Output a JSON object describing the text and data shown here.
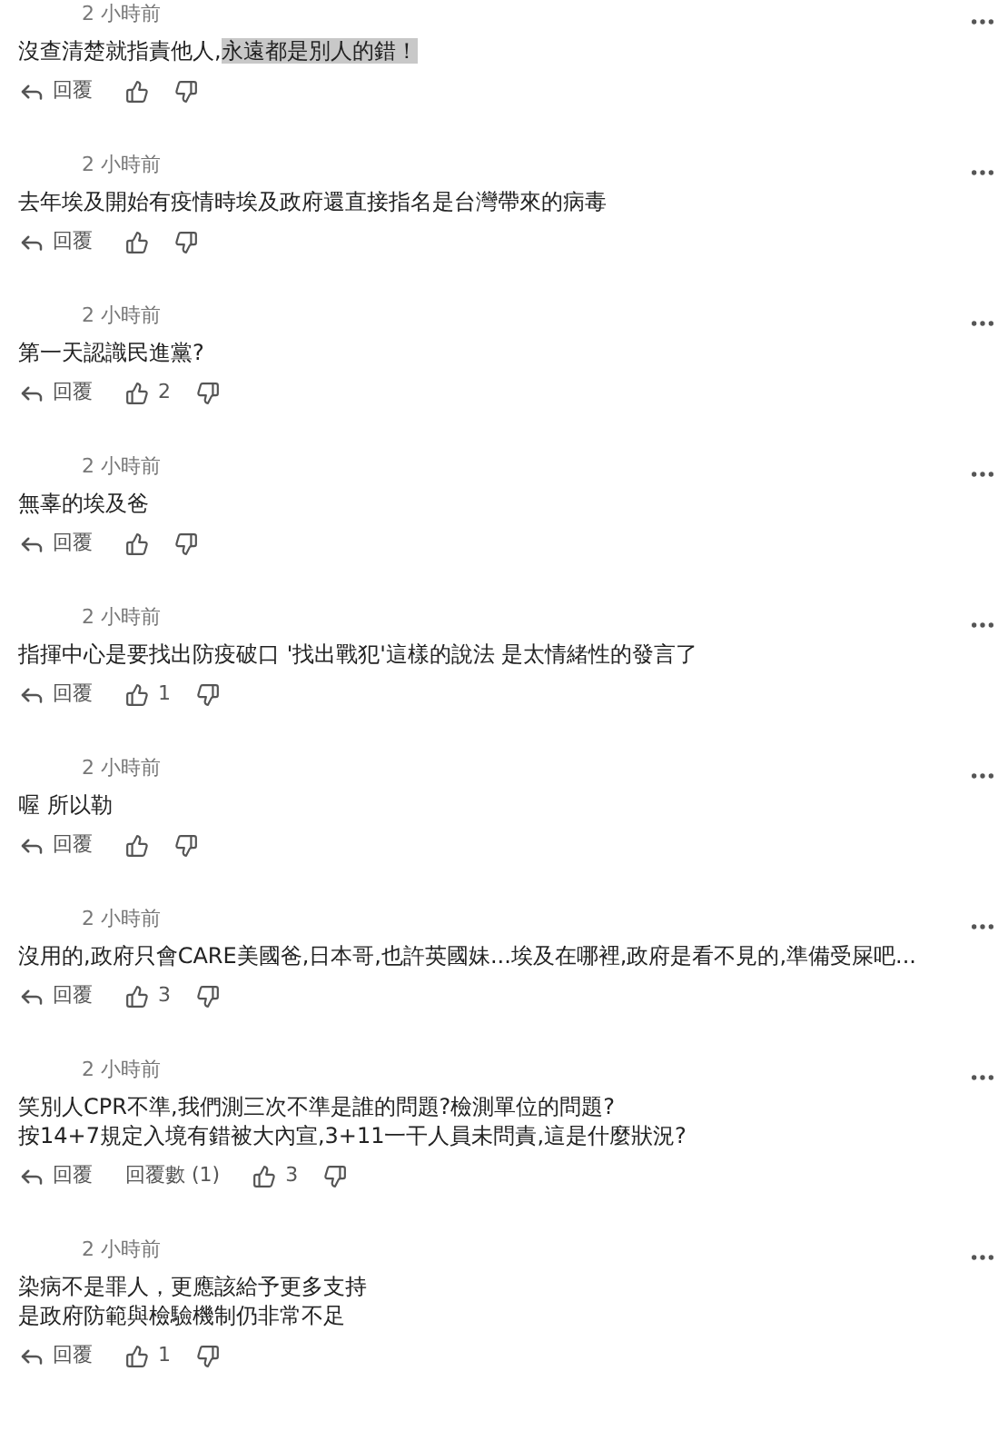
{
  "comments": [
    {
      "time": "2 小時前",
      "lines": [
        [
          {
            "text": "沒查清楚就指責他人,",
            "highlighted": false
          },
          {
            "text": "永遠都是別人的錯！",
            "highlighted": true
          }
        ]
      ],
      "reply_label": "回覆"
    },
    {
      "time": "2 小時前",
      "lines": [
        [
          {
            "text": "去年埃及開始有疫情時埃及政府還直接指名是台灣帶來的病毒",
            "highlighted": false
          }
        ]
      ],
      "reply_label": "回覆"
    },
    {
      "time": "2 小時前",
      "lines": [
        [
          {
            "text": "第一天認識民進黨?",
            "highlighted": false
          }
        ]
      ],
      "reply_label": "回覆",
      "likes": "2"
    },
    {
      "time": "2 小時前",
      "lines": [
        [
          {
            "text": "無辜的埃及爸",
            "highlighted": false
          }
        ]
      ],
      "reply_label": "回覆"
    },
    {
      "time": "2 小時前",
      "lines": [
        [
          {
            "text": "指揮中心是要找出防疫破口 '找出戰犯'這樣的說法 是太情緒性的發言了",
            "highlighted": false
          }
        ]
      ],
      "reply_label": "回覆",
      "likes": "1"
    },
    {
      "time": "2 小時前",
      "lines": [
        [
          {
            "text": "喔 所以勒",
            "highlighted": false
          }
        ]
      ],
      "reply_label": "回覆"
    },
    {
      "time": "2 小時前",
      "lines": [
        [
          {
            "text": "沒用的,政府只會CARE美國爸,日本哥,也許英國妹...埃及在哪裡,政府是看不見的,準備受屎吧...",
            "highlighted": false
          }
        ]
      ],
      "reply_label": "回覆",
      "likes": "3"
    },
    {
      "time": "2 小時前",
      "lines": [
        [
          {
            "text": "笑別人CPR不準,我們測三次不準是誰的問題?檢測單位的問題?",
            "highlighted": false
          }
        ],
        [
          {
            "text": "按14+7規定入境有錯被大內宣,3+11一干人員未問責,這是什麼狀況?",
            "highlighted": false
          }
        ]
      ],
      "reply_label": "回覆",
      "replies": "回覆數 (1)",
      "likes": "3"
    },
    {
      "time": "2 小時前",
      "lines": [
        [
          {
            "text": "染病不是罪人，更應該給予更多支持",
            "highlighted": false
          }
        ],
        [
          {
            "text": "是政府防範與檢驗機制仍非常不足",
            "highlighted": false
          }
        ]
      ],
      "reply_label": "回覆",
      "likes": "1"
    }
  ]
}
